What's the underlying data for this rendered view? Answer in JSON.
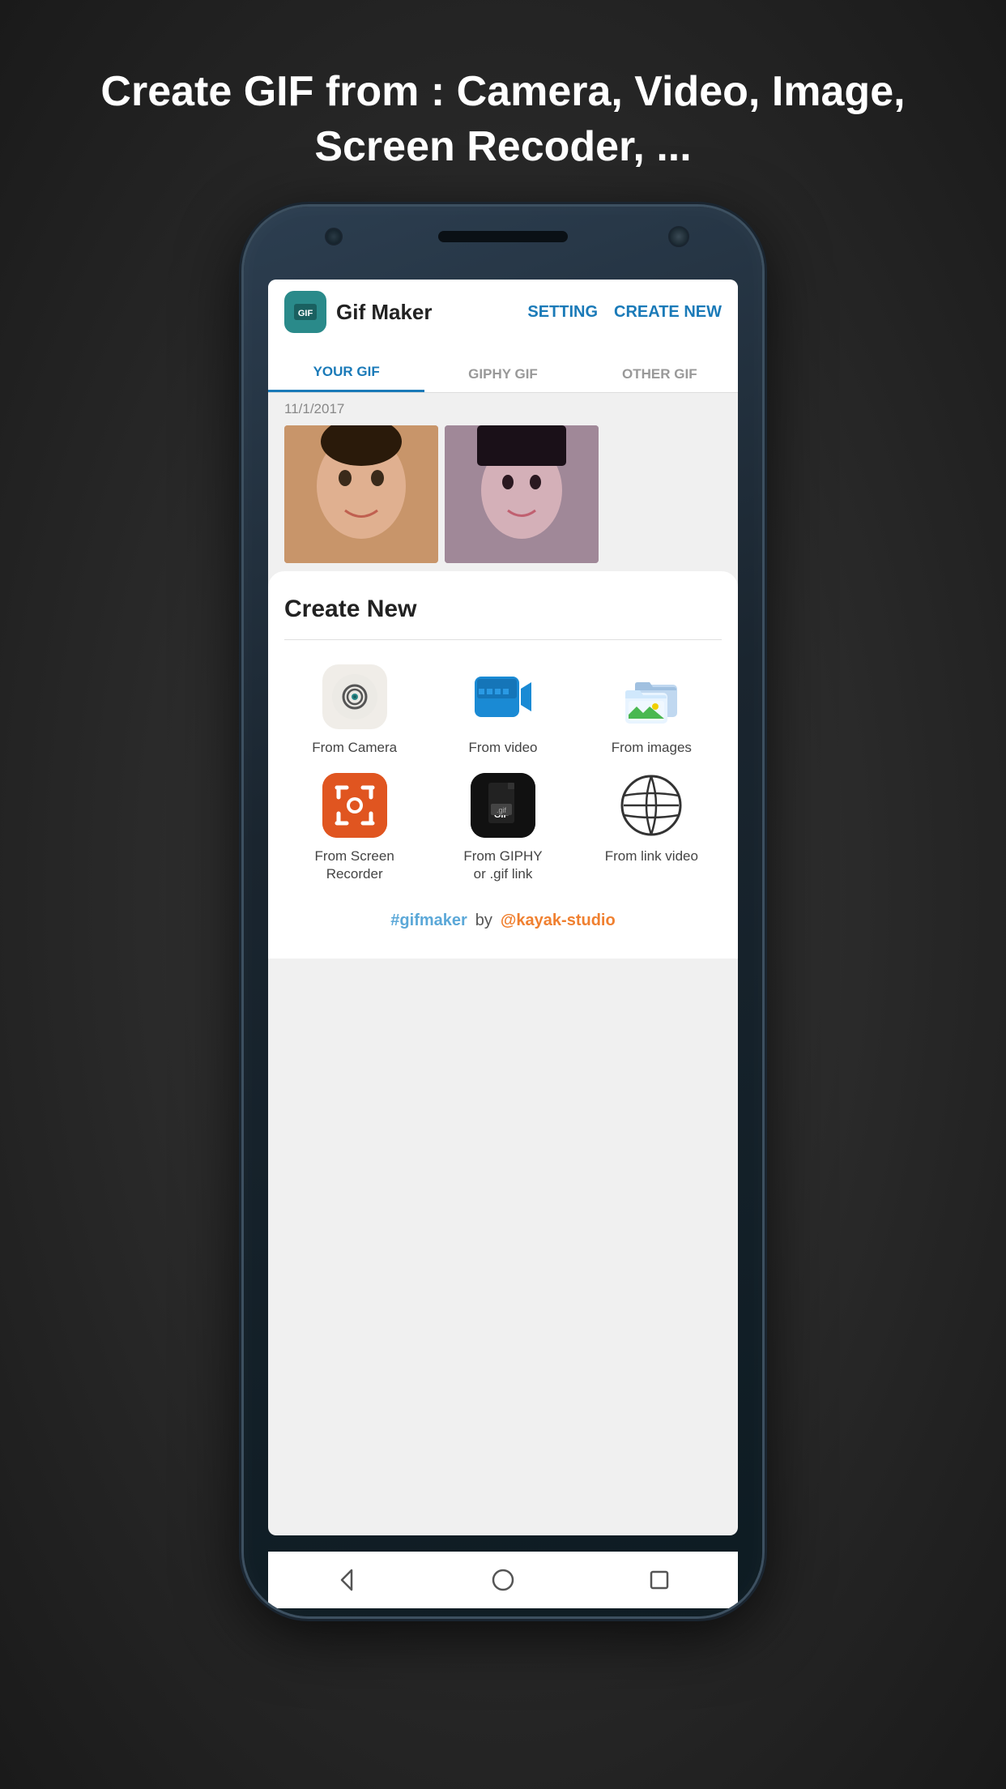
{
  "headline": {
    "text_plain": "Create GIF from : ",
    "text_bold": "Camera, Video, Image, Screen Recoder, ..."
  },
  "app_bar": {
    "app_name": "Gif Maker",
    "setting_label": "SETTING",
    "create_new_label": "CREATE NEW"
  },
  "tabs": [
    {
      "label": "YOUR GIF",
      "active": true
    },
    {
      "label": "GIPHY GIF",
      "active": false
    },
    {
      "label": "OTHER GIF",
      "active": false
    }
  ],
  "date_label": "11/1/2017",
  "create_new_title": "Create New",
  "options": [
    {
      "label": "From Camera",
      "icon": "camera"
    },
    {
      "label": "From video",
      "icon": "video"
    },
    {
      "label": "From images",
      "icon": "images"
    },
    {
      "label": "From Screen\nRecorder",
      "icon": "screen"
    },
    {
      "label": "From GIPHY\nor .gif link",
      "icon": "giphy"
    },
    {
      "label": "From link video",
      "icon": "link-video"
    }
  ],
  "footer": {
    "hashtag": "#gifmaker",
    "by": "by",
    "studio": "@kayak-studio"
  },
  "nav": {
    "back": "◁",
    "home": "○",
    "recents": "□"
  }
}
